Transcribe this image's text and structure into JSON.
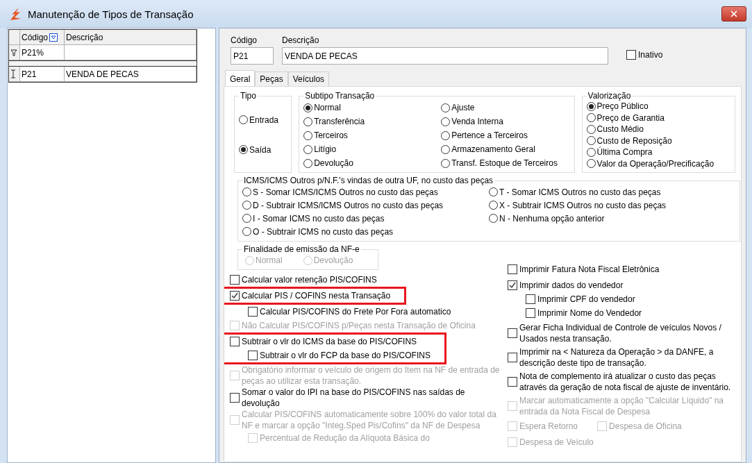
{
  "window": {
    "title": "Manutenção de Tipos de Transação"
  },
  "grid": {
    "columns": [
      "Código",
      "Descrição"
    ],
    "filter": [
      "P21%"
    ],
    "rows": [
      {
        "cells": [
          "P21",
          "VENDA DE PECAS"
        ]
      }
    ]
  },
  "form": {
    "codigo": {
      "label": "Código",
      "value": "P21"
    },
    "descricao": {
      "label": "Descrição",
      "value": "VENDA DE PECAS"
    },
    "inativo": {
      "label": "Inativo",
      "checked": false
    }
  },
  "tabs": [
    {
      "label": "Geral",
      "selected": true
    },
    {
      "label": "Peças",
      "selected": false
    },
    {
      "label": "Veículos",
      "selected": false
    }
  ],
  "tipo": {
    "title": "Tipo",
    "options": [
      {
        "label": "Entrada",
        "selected": false
      },
      {
        "label": "Saída",
        "selected": true
      }
    ]
  },
  "subtipo": {
    "title": "Subtipo Transação",
    "options": [
      {
        "label": "Normal",
        "selected": true
      },
      {
        "label": "Transferência",
        "selected": false
      },
      {
        "label": "Terceiros",
        "selected": false
      },
      {
        "label": "Litígio",
        "selected": false
      },
      {
        "label": "Devolução",
        "selected": false
      },
      {
        "label": "Ajuste",
        "selected": false
      },
      {
        "label": "Venda Interna",
        "selected": false
      },
      {
        "label": "Pertence a Terceiros",
        "selected": false
      },
      {
        "label": "Armazenamento Geral",
        "selected": false
      },
      {
        "label": "Transf. Estoque de Terceiros",
        "selected": false
      }
    ]
  },
  "valorizacao": {
    "title": "Valorização",
    "options": [
      {
        "label": "Preço Público",
        "selected": true
      },
      {
        "label": "Preço de Garantia",
        "selected": false
      },
      {
        "label": "Custo Médio",
        "selected": false
      },
      {
        "label": "Custo de Reposição",
        "selected": false
      },
      {
        "label": "Última Compra",
        "selected": false
      },
      {
        "label": "Valor da Operação/Precificação",
        "selected": false
      }
    ]
  },
  "icms": {
    "title": "ICMS/ICMS Outros p/N.F.'s vindas de outra UF, no custo das peças",
    "options": [
      {
        "label": "S - Somar ICMS/ICMS Outros no custo das peças",
        "selected": false
      },
      {
        "label": "D - Subtrair ICMS/ICMS Outros no custo das peças",
        "selected": false
      },
      {
        "label": "I - Somar ICMS no custo das peças",
        "selected": false
      },
      {
        "label": "O - Subtrair ICMS no custo das peças",
        "selected": false
      },
      {
        "label": "T - Somar ICMS Outros no custo das peças",
        "selected": false
      },
      {
        "label": "X - Subtrair ICMS Outros no custo das peças",
        "selected": false
      },
      {
        "label": "N - Nenhuma opção anterior",
        "selected": false
      }
    ]
  },
  "finalidade": {
    "title": "Finalidade de emissão da NF-e",
    "disabled": true,
    "options": [
      {
        "label": "Normal",
        "selected": false
      },
      {
        "label": "Devolução",
        "selected": false
      }
    ]
  },
  "left_options": [
    {
      "label": "Calcular valor retenção PIS/COFINS",
      "checked": false,
      "disabled": false
    },
    {
      "label": "Calcular PIS / COFINS nesta Transação",
      "checked": true,
      "disabled": false,
      "highlighted": true,
      "children": [
        {
          "label": "Calcular PIS/COFINS do Frete Por Fora automatico",
          "checked": false,
          "disabled": false
        }
      ]
    },
    {
      "label": "Não Calcular PIS/COFINS p/Peças nesta Transação de Oficina",
      "checked": false,
      "disabled": true
    },
    {
      "label": "Subtrair o vlr do ICMS da base do PIS/COFINS",
      "checked": false,
      "disabled": false,
      "highlighted": true,
      "children": [
        {
          "label": "Subtrair o vlr do FCP da base do PIS/COFINS",
          "checked": false,
          "disabled": false,
          "highlighted": true
        }
      ]
    },
    {
      "label": "Obrigatório informar o veículo de origem do Item na NF de entrada de peças ao utilizar esta transação.",
      "checked": false,
      "disabled": true
    },
    {
      "label": "Somar o valor do IPI na base do PIS/COFINS nas saídas de devolução",
      "checked": false,
      "disabled": false
    },
    {
      "label": "Calcular PIS/COFINS automaticamente sobre 100% do valor total da NF e marcar a opção \"Integ.Sped Pis/Cofins\" da NF de Despesa",
      "checked": false,
      "disabled": true,
      "children": [
        {
          "label": "Percentual de Redução da Alíquota Básica do",
          "checked": false,
          "disabled": true
        }
      ]
    }
  ],
  "right_options": [
    {
      "kind": "check",
      "label": "Imprimir Fatura Nota Fiscal Eletrônica",
      "checked": false,
      "disabled": false
    },
    {
      "kind": "check",
      "label": "Imprimir dados do vendedor",
      "checked": true,
      "disabled": false,
      "children": [
        {
          "label": "Imprimir CPF do vendedor",
          "checked": false,
          "disabled": false
        },
        {
          "label": "Imprimir Nome do Vendedor",
          "checked": false,
          "disabled": false
        }
      ]
    },
    {
      "kind": "check",
      "label": "Gerar Ficha Individual de Controle de veículos Novos / Usados  nesta transação.",
      "checked": false,
      "disabled": false
    },
    {
      "kind": "check",
      "label": "Imprimir na < Natureza da Operação > da DANFE, a descrição deste tipo de transação.",
      "checked": false,
      "disabled": false
    },
    {
      "kind": "check",
      "label": "Nota de complemento irá atualizar o custo das peças através da geração de nota fiscal de ajuste de inventário.",
      "checked": false,
      "disabled": false
    },
    {
      "kind": "check",
      "label": "Marcar automaticamente a opção \"Calcular Líquido\" na entrada da Nota Fiscal de Despesa",
      "checked": false,
      "disabled": true
    },
    {
      "kind": "pair",
      "items": [
        {
          "label": "Espera Retorno",
          "checked": false,
          "disabled": true
        },
        {
          "label": "Despesa de Oficina",
          "checked": false,
          "disabled": true
        }
      ]
    },
    {
      "kind": "check",
      "label": "Despesa de Veículo",
      "checked": false,
      "disabled": true
    }
  ]
}
